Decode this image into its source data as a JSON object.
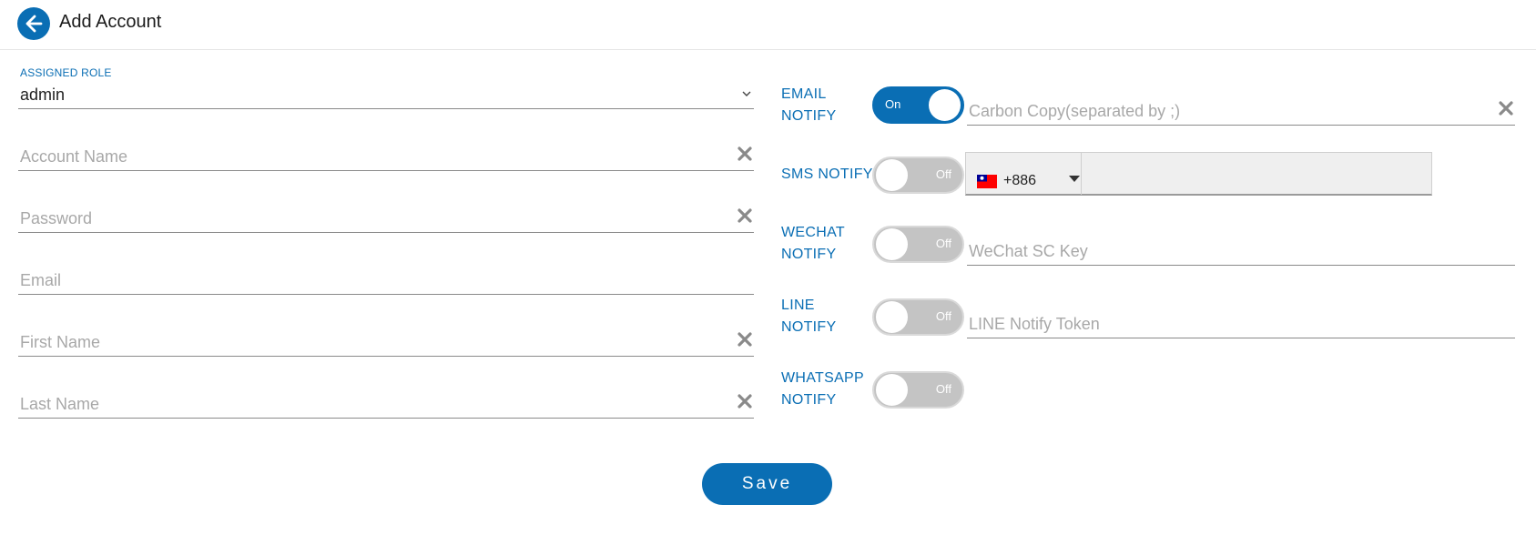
{
  "header": {
    "title": "Add Account"
  },
  "form": {
    "role": {
      "label": "ASSIGNED ROLE",
      "value": "admin"
    },
    "account_name": {
      "placeholder": "Account Name"
    },
    "password": {
      "placeholder": "Password"
    },
    "email": {
      "placeholder": "Email"
    },
    "first_name": {
      "placeholder": "First Name"
    },
    "last_name": {
      "placeholder": "Last Name"
    }
  },
  "notify": {
    "email": {
      "label_line1": "EMAIL",
      "label_line2": "NOTIFY",
      "toggle_text": "On",
      "state": "on",
      "cc_placeholder": "Carbon Copy(separated by ;)"
    },
    "sms": {
      "label": "SMS NOTIFY",
      "toggle_text": "Off",
      "state": "off",
      "dial_code": "+886",
      "flag": "taiwan-flag"
    },
    "wechat": {
      "label_line1": "WECHAT",
      "label_line2": "NOTIFY",
      "toggle_text": "Off",
      "state": "off",
      "key_placeholder": "WeChat SC Key"
    },
    "line": {
      "label_line1": "LINE",
      "label_line2": "NOTIFY",
      "toggle_text": "Off",
      "state": "off",
      "token_placeholder": "LINE Notify Token"
    },
    "whatsapp": {
      "label_line1": "WHATSAPP",
      "label_line2": "NOTIFY",
      "toggle_text": "Off",
      "state": "off"
    }
  },
  "actions": {
    "save_label": "Save"
  },
  "colors": {
    "accent": "#0a6eb4",
    "toggle_off": "#c4c4c4",
    "placeholder": "#a8a8a8"
  }
}
